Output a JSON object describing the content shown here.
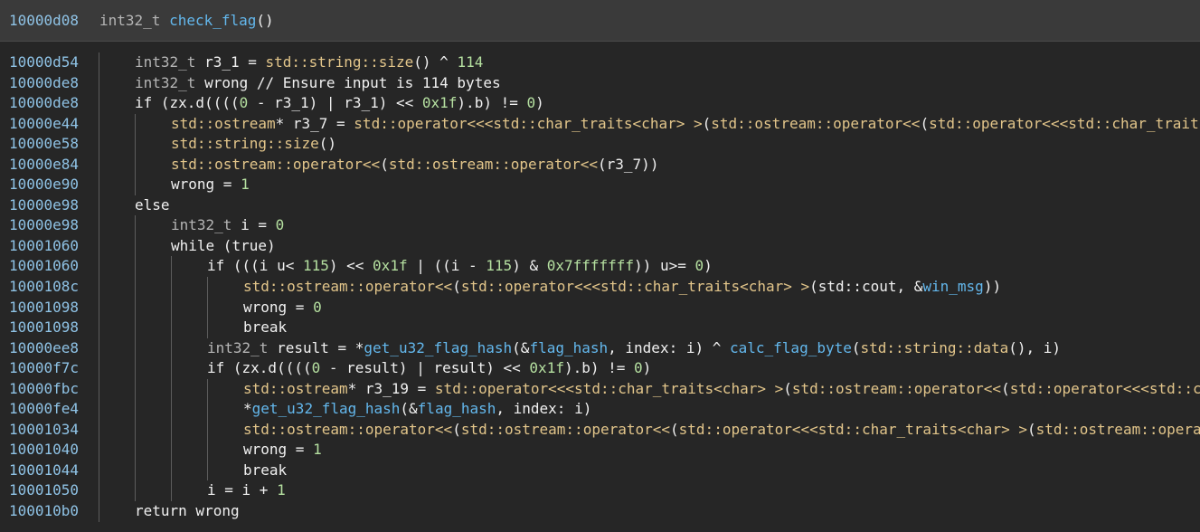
{
  "header": {
    "address": "10000d08",
    "return_type": "int32_t",
    "function_name": "check_flag",
    "params": "()"
  },
  "rows": [
    {
      "address": "10000d54",
      "indent": 1,
      "tokens": [
        {
          "t": "int32_t",
          "c": "ty"
        },
        {
          "t": " r3_1 = ",
          "c": "var"
        },
        {
          "t": "std::string::size",
          "c": "fn"
        },
        {
          "t": "() ^ ",
          "c": "op"
        },
        {
          "t": "114",
          "c": "num"
        }
      ]
    },
    {
      "address": "10000de8",
      "indent": 1,
      "tokens": [
        {
          "t": "int32_t",
          "c": "ty"
        },
        {
          "t": " wrong  // Ensure input is 114 bytes",
          "c": "cm"
        }
      ]
    },
    {
      "address": "10000de8",
      "indent": 1,
      "tokens": [
        {
          "t": "if",
          "c": "kw"
        },
        {
          "t": " (zx.d((((",
          "c": "op"
        },
        {
          "t": "0",
          "c": "num"
        },
        {
          "t": " - r3_1) | r3_1) << ",
          "c": "op"
        },
        {
          "t": "0x1f",
          "c": "num"
        },
        {
          "t": ").b) != ",
          "c": "op"
        },
        {
          "t": "0",
          "c": "num"
        },
        {
          "t": ")",
          "c": "op"
        }
      ]
    },
    {
      "address": "10000e44",
      "indent": 2,
      "tokens": [
        {
          "t": "std::ostream",
          "c": "fn"
        },
        {
          "t": "* r3_7 = ",
          "c": "op"
        },
        {
          "t": "std::operator<<<std::char_traits<char> >",
          "c": "fn"
        },
        {
          "t": "(",
          "c": "op"
        },
        {
          "t": "std::ostream::operator<<",
          "c": "fn"
        },
        {
          "t": "(",
          "c": "op"
        },
        {
          "t": "std::operator<<<std::char_traits<char> >(std::cout, &flag_len_msg)",
          "c": "fn"
        }
      ]
    },
    {
      "address": "10000e58",
      "indent": 2,
      "tokens": [
        {
          "t": "std::string::size",
          "c": "fn"
        },
        {
          "t": "()",
          "c": "op"
        }
      ]
    },
    {
      "address": "10000e84",
      "indent": 2,
      "tokens": [
        {
          "t": "std::ostream::operator<<",
          "c": "fn"
        },
        {
          "t": "(",
          "c": "op"
        },
        {
          "t": "std::ostream::operator<<",
          "c": "fn"
        },
        {
          "t": "(r3_7))",
          "c": "op"
        }
      ]
    },
    {
      "address": "10000e90",
      "indent": 2,
      "tokens": [
        {
          "t": "wrong = ",
          "c": "var"
        },
        {
          "t": "1",
          "c": "num"
        }
      ]
    },
    {
      "address": "10000e98",
      "indent": 1,
      "tokens": [
        {
          "t": "else",
          "c": "kw"
        }
      ]
    },
    {
      "address": "10000e98",
      "indent": 2,
      "tokens": [
        {
          "t": "int32_t",
          "c": "ty"
        },
        {
          "t": " i = ",
          "c": "var"
        },
        {
          "t": "0",
          "c": "num"
        }
      ]
    },
    {
      "address": "10001060",
      "indent": 2,
      "tokens": [
        {
          "t": "while",
          "c": "kw"
        },
        {
          "t": " (true)",
          "c": "op"
        }
      ]
    },
    {
      "address": "10001060",
      "indent": 3,
      "tokens": [
        {
          "t": "if",
          "c": "kw"
        },
        {
          "t": " (((i u< ",
          "c": "op"
        },
        {
          "t": "115",
          "c": "num"
        },
        {
          "t": ") << ",
          "c": "op"
        },
        {
          "t": "0x1f",
          "c": "num"
        },
        {
          "t": " | ((i - ",
          "c": "op"
        },
        {
          "t": "115",
          "c": "num"
        },
        {
          "t": ") & ",
          "c": "op"
        },
        {
          "t": "0x7fffffff",
          "c": "num"
        },
        {
          "t": ")) u>= ",
          "c": "op"
        },
        {
          "t": "0",
          "c": "num"
        },
        {
          "t": ")",
          "c": "op"
        }
      ]
    },
    {
      "address": "1000108c",
      "indent": 4,
      "tokens": [
        {
          "t": "std::ostream::operator<<",
          "c": "fn"
        },
        {
          "t": "(",
          "c": "op"
        },
        {
          "t": "std::operator<<<std::char_traits<char> >",
          "c": "fn"
        },
        {
          "t": "(std::cout, &",
          "c": "op"
        },
        {
          "t": "win_msg",
          "c": "fl"
        },
        {
          "t": "))",
          "c": "op"
        }
      ]
    },
    {
      "address": "10001098",
      "indent": 4,
      "tokens": [
        {
          "t": "wrong = ",
          "c": "var"
        },
        {
          "t": "0",
          "c": "num"
        }
      ]
    },
    {
      "address": "10001098",
      "indent": 4,
      "tokens": [
        {
          "t": "break",
          "c": "kw"
        }
      ]
    },
    {
      "address": "10000ee8",
      "indent": 3,
      "tokens": [
        {
          "t": "int32_t",
          "c": "ty"
        },
        {
          "t": " result = *",
          "c": "var"
        },
        {
          "t": "get_u32_flag_hash",
          "c": "fl"
        },
        {
          "t": "(&",
          "c": "op"
        },
        {
          "t": "flag_hash",
          "c": "fl"
        },
        {
          "t": ", index: i) ^ ",
          "c": "op"
        },
        {
          "t": "calc_flag_byte",
          "c": "fl"
        },
        {
          "t": "(",
          "c": "op"
        },
        {
          "t": "std::string::data",
          "c": "fn"
        },
        {
          "t": "(), i)",
          "c": "op"
        }
      ]
    },
    {
      "address": "10000f7c",
      "indent": 3,
      "tokens": [
        {
          "t": "if",
          "c": "kw"
        },
        {
          "t": " (zx.d((((",
          "c": "op"
        },
        {
          "t": "0",
          "c": "num"
        },
        {
          "t": " - result) | result) << ",
          "c": "op"
        },
        {
          "t": "0x1f",
          "c": "num"
        },
        {
          "t": ").b) != ",
          "c": "op"
        },
        {
          "t": "0",
          "c": "num"
        },
        {
          "t": ")",
          "c": "op"
        }
      ]
    },
    {
      "address": "10000fbc",
      "indent": 4,
      "tokens": [
        {
          "t": "std::ostream",
          "c": "fn"
        },
        {
          "t": "* r3_19 = ",
          "c": "op"
        },
        {
          "t": "std::operator<<<std::char_traits<char> >",
          "c": "fn"
        },
        {
          "t": "(",
          "c": "op"
        },
        {
          "t": "std::ostream::operator<<",
          "c": "fn"
        },
        {
          "t": "(",
          "c": "op"
        },
        {
          "t": "std::operator<<<std::char_traits<char> >",
          "c": "fn"
        }
      ]
    },
    {
      "address": "10000fe4",
      "indent": 4,
      "tokens": [
        {
          "t": "*",
          "c": "op"
        },
        {
          "t": "get_u32_flag_hash",
          "c": "fl"
        },
        {
          "t": "(&",
          "c": "op"
        },
        {
          "t": "flag_hash",
          "c": "fl"
        },
        {
          "t": ", index: i)",
          "c": "op"
        }
      ]
    },
    {
      "address": "10001034",
      "indent": 4,
      "tokens": [
        {
          "t": "std::ostream::operator<<",
          "c": "fn"
        },
        {
          "t": "(",
          "c": "op"
        },
        {
          "t": "std::ostream::operator<<",
          "c": "fn"
        },
        {
          "t": "(",
          "c": "op"
        },
        {
          "t": "std::operator<<<std::char_traits<char> >",
          "c": "fn"
        },
        {
          "t": "(",
          "c": "op"
        },
        {
          "t": "std::ostream::operator<<",
          "c": "fn"
        }
      ]
    },
    {
      "address": "10001040",
      "indent": 4,
      "tokens": [
        {
          "t": "wrong = ",
          "c": "var"
        },
        {
          "t": "1",
          "c": "num"
        }
      ]
    },
    {
      "address": "10001044",
      "indent": 4,
      "tokens": [
        {
          "t": "break",
          "c": "kw"
        }
      ]
    },
    {
      "address": "10001050",
      "indent": 3,
      "tokens": [
        {
          "t": "i = i + ",
          "c": "var"
        },
        {
          "t": "1",
          "c": "num"
        }
      ]
    },
    {
      "address": "100010b0",
      "indent": 1,
      "tokens": [
        {
          "t": "return",
          "c": "kw"
        },
        {
          "t": " wrong",
          "c": "var"
        }
      ]
    }
  ],
  "colors": {
    "background": "#262626",
    "header_background": "#3a3a3a",
    "address": "#8fc3e6",
    "type": "#b5b5b5",
    "function": "#e2c58a",
    "symbol": "#63b7ec",
    "number": "#b5e0a0",
    "text": "#f0f0f0",
    "indent_guide": "#5c5c5c"
  }
}
